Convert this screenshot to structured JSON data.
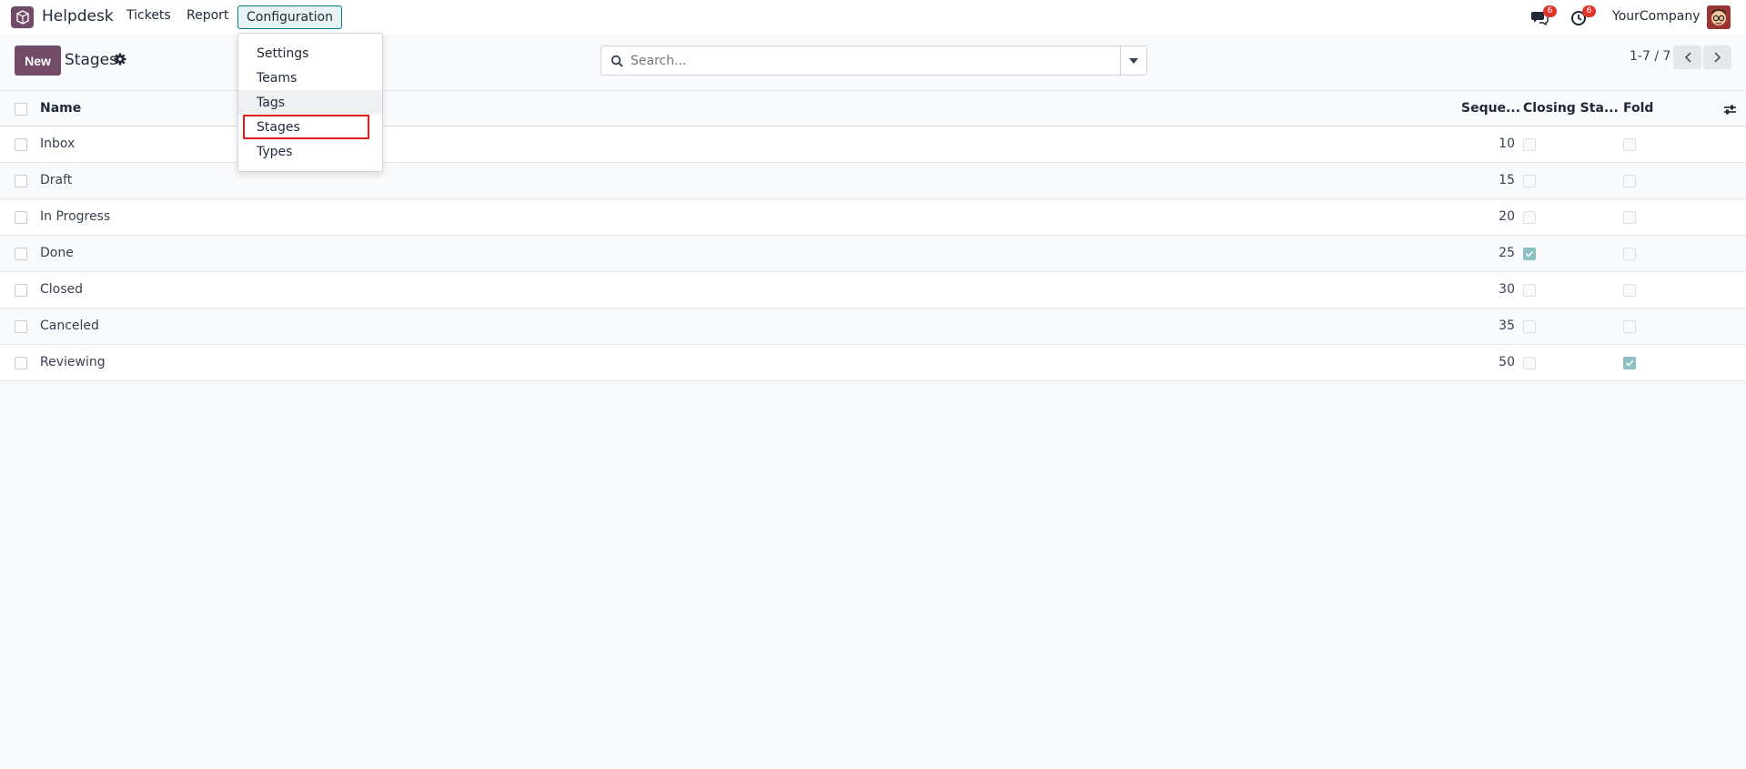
{
  "app": {
    "name": "Helpdesk"
  },
  "nav": {
    "items": [
      {
        "label": "Tickets"
      },
      {
        "label": "Report"
      },
      {
        "label": "Configuration"
      }
    ],
    "messages_badge": "6",
    "activities_badge": "6",
    "company": "YourCompany"
  },
  "control_panel": {
    "new_label": "New",
    "title": "Stages",
    "search_placeholder": "Search...",
    "pager": "1-7 / 7"
  },
  "table": {
    "columns": {
      "name": "Name",
      "sequence": "Seque...",
      "closing": "Closing Sta...",
      "fold": "Fold"
    },
    "rows": [
      {
        "name": "Inbox",
        "sequence": "10",
        "closing": false,
        "fold": false
      },
      {
        "name": "Draft",
        "sequence": "15",
        "closing": false,
        "fold": false
      },
      {
        "name": "In Progress",
        "sequence": "20",
        "closing": false,
        "fold": false
      },
      {
        "name": "Done",
        "sequence": "25",
        "closing": true,
        "fold": false
      },
      {
        "name": "Closed",
        "sequence": "30",
        "closing": false,
        "fold": false
      },
      {
        "name": "Canceled",
        "sequence": "35",
        "closing": false,
        "fold": false
      },
      {
        "name": "Reviewing",
        "sequence": "50",
        "closing": false,
        "fold": true
      }
    ]
  },
  "dropdown": {
    "items": [
      {
        "label": "Settings"
      },
      {
        "label": "Teams"
      },
      {
        "label": "Tags"
      },
      {
        "label": "Stages"
      },
      {
        "label": "Types"
      }
    ]
  },
  "colors": {
    "brand": "#714B67",
    "accent": "#017e84",
    "badge": "#e0352b",
    "check": "#8cc0c3",
    "highlight": "#e21c1c"
  },
  "icons": [
    "app-logo-icon",
    "chat-icon",
    "clock-icon",
    "gear-icon",
    "search-icon",
    "caret-down-icon",
    "chevron-left-icon",
    "chevron-right-icon",
    "column-settings-icon"
  ]
}
